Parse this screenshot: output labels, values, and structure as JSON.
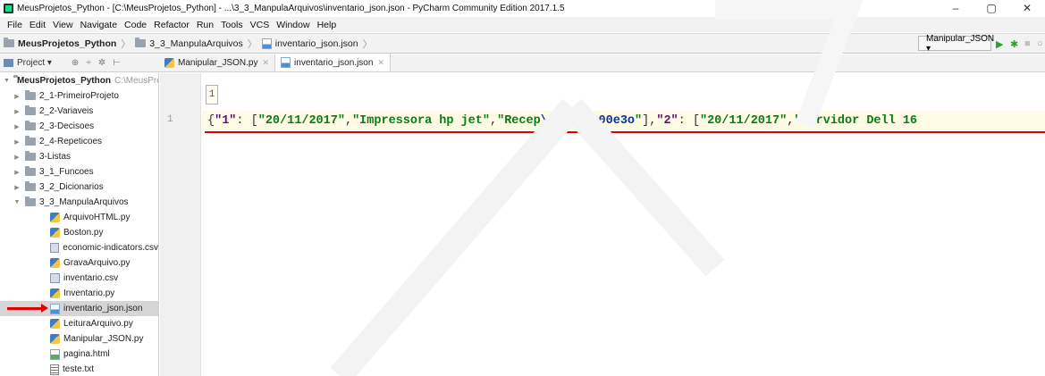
{
  "window": {
    "title": "MeusProjetos_Python - [C:\\MeusProjetos_Python] - ...\\3_3_ManpulaArquivos\\inventario_json.json - PyCharm Community Edition 2017.1.5",
    "controls": {
      "minimize": "–",
      "maximize": "▢",
      "close": "✕"
    }
  },
  "menu": [
    "File",
    "Edit",
    "View",
    "Navigate",
    "Code",
    "Refactor",
    "Run",
    "Tools",
    "VCS",
    "Window",
    "Help"
  ],
  "breadcrumb": {
    "project": "MeusProjetos_Python",
    "folder": "3_3_ManpulaArquivos",
    "file": "inventario_json.json"
  },
  "run_config": {
    "label": "Manipular_JSON ▾"
  },
  "tool_window": {
    "label": "Project ▾"
  },
  "tabs": [
    {
      "label": "Manipular_JSON.py",
      "icon": "python-file-icon",
      "active": false
    },
    {
      "label": "inventario_json.json",
      "icon": "json-file-icon",
      "active": true
    }
  ],
  "tree": {
    "root": {
      "label": "MeusProjetos_Python",
      "hint": "C:\\MeusPro"
    },
    "folders": [
      "2_1-PrimeiroProjeto",
      "2_2-Variaveis",
      "2_3-Decisoes",
      "2_4-Repeticoes",
      "3-Listas",
      "3_1_Funcoes",
      "3_2_Dicionarios"
    ],
    "open_folder": "3_3_ManpulaArquivos",
    "files": [
      {
        "label": "ArquivoHTML.py",
        "type": "py"
      },
      {
        "label": "Boston.py",
        "type": "py"
      },
      {
        "label": "economic-indicators.csv",
        "type": "csv"
      },
      {
        "label": "GravaArquivo.py",
        "type": "py"
      },
      {
        "label": "inventario.csv",
        "type": "csv"
      },
      {
        "label": "Inventario.py",
        "type": "py"
      },
      {
        "label": "inventario_json.json",
        "type": "json",
        "selected": true
      },
      {
        "label": "LeituraArquivo.py",
        "type": "py"
      },
      {
        "label": "Manipular_JSON.py",
        "type": "py"
      },
      {
        "label": "pagina.html",
        "type": "html"
      },
      {
        "label": "teste.txt",
        "type": "txt"
      }
    ]
  },
  "editor": {
    "crumb": "1",
    "line_number": "1",
    "tokens": [
      {
        "t": "{",
        "c": "c-brace"
      },
      {
        "t": "\"1\"",
        "c": "c-key"
      },
      {
        "t": ": [",
        "c": "c-punc"
      },
      {
        "t": "\"20/11/2017\"",
        "c": "c-str"
      },
      {
        "t": ", ",
        "c": "c-punc"
      },
      {
        "t": "\"Impressora hp jet\"",
        "c": "c-str"
      },
      {
        "t": ", ",
        "c": "c-punc"
      },
      {
        "t": "\"Recep",
        "c": "c-str"
      },
      {
        "t": "\\u00e7\\u00e3o",
        "c": "c-esc"
      },
      {
        "t": "\"",
        "c": "c-str"
      },
      {
        "t": "], ",
        "c": "c-punc"
      },
      {
        "t": "\"2\"",
        "c": "c-key"
      },
      {
        "t": ": [",
        "c": "c-punc"
      },
      {
        "t": "\"20/11/2017\"",
        "c": "c-str"
      },
      {
        "t": ", ",
        "c": "c-punc"
      },
      {
        "t": "\"Servidor Dell 16",
        "c": "c-str"
      }
    ]
  }
}
